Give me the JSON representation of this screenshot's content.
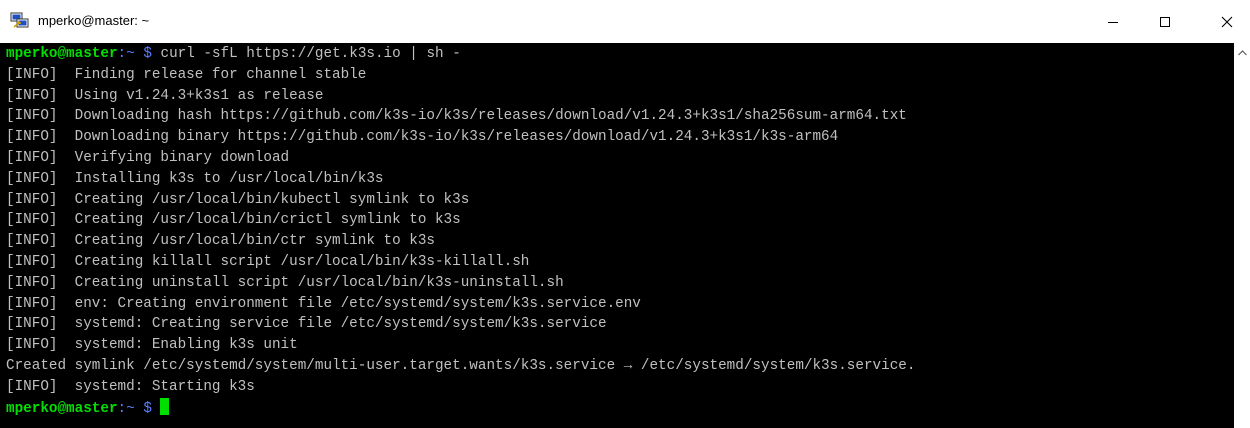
{
  "window": {
    "title": "mperko@master: ~",
    "app_icon": "putty-terminal-icon"
  },
  "controls": {
    "minimize_icon": "minimize-icon",
    "maximize_icon": "maximize-icon",
    "close_icon": "close-icon"
  },
  "terminal": {
    "prompt": {
      "user_host": "mperko@master",
      "separator": ":",
      "dir": "~",
      "symbol": " $ "
    },
    "command": "curl -sfL https://get.k3s.io | sh -",
    "output": [
      "[INFO]  Finding release for channel stable",
      "[INFO]  Using v1.24.3+k3s1 as release",
      "[INFO]  Downloading hash https://github.com/k3s-io/k3s/releases/download/v1.24.3+k3s1/sha256sum-arm64.txt",
      "[INFO]  Downloading binary https://github.com/k3s-io/k3s/releases/download/v1.24.3+k3s1/k3s-arm64",
      "[INFO]  Verifying binary download",
      "[INFO]  Installing k3s to /usr/local/bin/k3s",
      "[INFO]  Creating /usr/local/bin/kubectl symlink to k3s",
      "[INFO]  Creating /usr/local/bin/crictl symlink to k3s",
      "[INFO]  Creating /usr/local/bin/ctr symlink to k3s",
      "[INFO]  Creating killall script /usr/local/bin/k3s-killall.sh",
      "[INFO]  Creating uninstall script /usr/local/bin/k3s-uninstall.sh",
      "[INFO]  env: Creating environment file /etc/systemd/system/k3s.service.env",
      "[INFO]  systemd: Creating service file /etc/systemd/system/k3s.service",
      "[INFO]  systemd: Enabling k3s unit",
      "Created symlink /etc/systemd/system/multi-user.target.wants/k3s.service → /etc/systemd/system/k3s.service.",
      "[INFO]  systemd: Starting k3s"
    ],
    "colors": {
      "background": "#000000",
      "text": "#c0c0c0",
      "prompt_user": "#00e000",
      "prompt_path": "#5a7dff",
      "cursor": "#00e000"
    }
  },
  "scrollbar": {
    "up_arrow_icon": "scroll-up-arrow-icon"
  }
}
